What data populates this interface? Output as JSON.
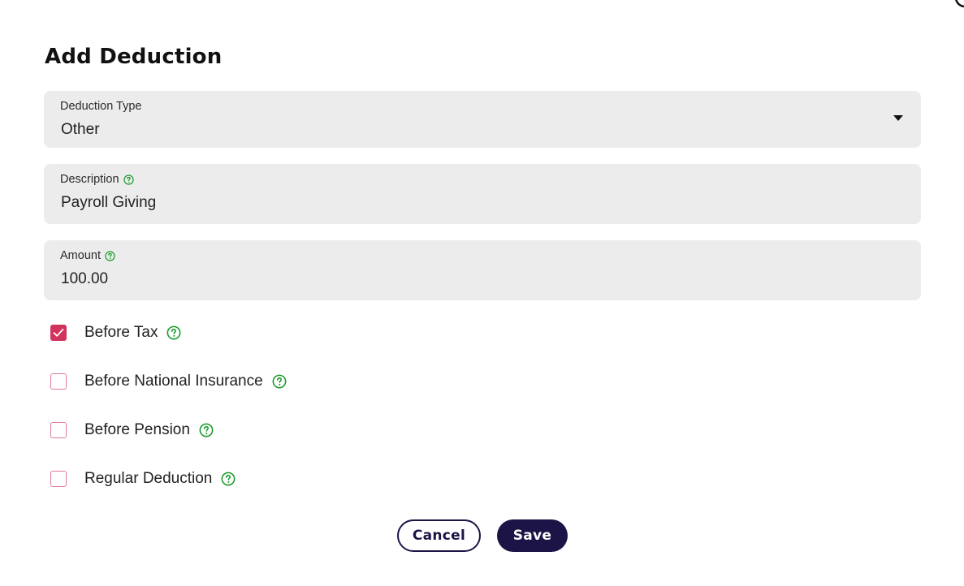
{
  "dialog": {
    "title": "Add Deduction"
  },
  "fields": {
    "deduction_type": {
      "label": "Deduction Type",
      "value": "Other"
    },
    "description": {
      "label": "Description",
      "value": "Payroll Giving"
    },
    "amount": {
      "label": "Amount",
      "value": "100.00"
    }
  },
  "checkboxes": [
    {
      "label": "Before Tax",
      "checked": true
    },
    {
      "label": "Before National Insurance",
      "checked": false
    },
    {
      "label": "Before Pension",
      "checked": false
    },
    {
      "label": "Regular Deduction",
      "checked": false
    }
  ],
  "buttons": {
    "cancel_label": "Cancel",
    "save_label": "Save"
  },
  "icons": {
    "help": "help-circle-icon",
    "dropdown": "caret-down-icon",
    "check": "checkmark-icon",
    "close": "close-icon"
  },
  "colors": {
    "accent": "#d1335d",
    "checkbox_border": "#e07a95",
    "help_icon": "#1a9a2a",
    "primary_button": "#1c1446",
    "field_background": "#ececec"
  }
}
